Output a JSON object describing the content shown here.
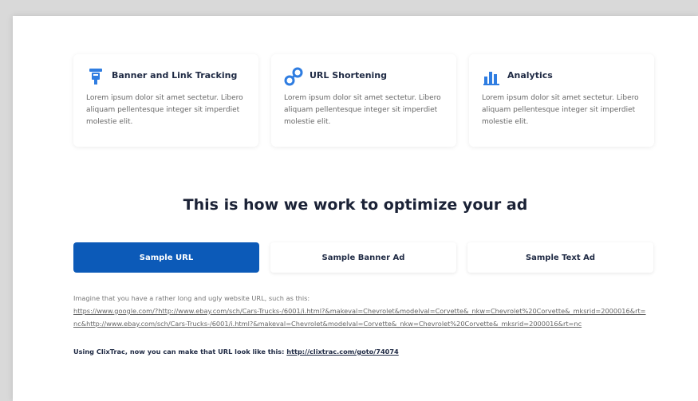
{
  "features": [
    {
      "icon": "banner-tracking-icon",
      "title": "Banner and Link Tracking",
      "desc": "Lorem ipsum dolor sit amet sectetur. Libero aliquam pellentesque integer sit imperdiet molestie elit."
    },
    {
      "icon": "link-icon",
      "title": "URL Shortening",
      "desc": "Lorem ipsum dolor sit amet sectetur. Libero aliquam pellentesque integer sit imperdiet molestie elit."
    },
    {
      "icon": "analytics-icon",
      "title": "Analytics",
      "desc": "Lorem ipsum dolor sit amet sectetur. Libero aliquam pellentesque integer sit imperdiet molestie elit."
    }
  ],
  "section_title": "This is how we work to optimize your ad",
  "tabs": [
    {
      "label": "Sample URL",
      "active": true
    },
    {
      "label": "Sample Banner Ad",
      "active": false
    },
    {
      "label": "Sample Text Ad",
      "active": false
    }
  ],
  "content": {
    "intro": "Imagine that you have a rather long and ugly website URL, such as this:",
    "long_url": "https://www.google.com/?http://www.ebay.com/sch/Cars-Trucks-/6001/i.html?&makeval=Chevrolet&modelval=Corvette&_nkw=Chevrolet%20Corvette&_mksrid=2000016&rt=nc&http://www.ebay.com/sch/Cars-Trucks-/6001/i.html?&makeval=Chevrolet&modelval=Corvette&_nkw=Chevrolet%20Corvette&_mksrid=2000016&rt=nc",
    "result_prefix": "Using ClixTrac, now you can make that URL look like this: ",
    "short_url": "http://clixtrac.com/goto/74074"
  },
  "colors": {
    "accent": "#0c5ab8",
    "title": "#1b2236",
    "icon": "#2f7de1"
  }
}
